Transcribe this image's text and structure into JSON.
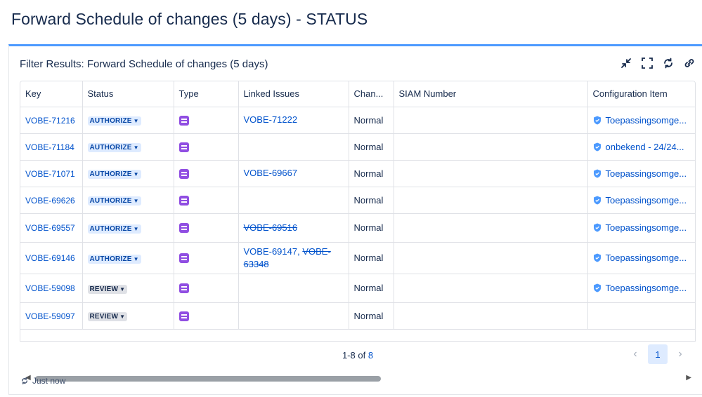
{
  "page": {
    "title": "Forward Schedule of changes (5 days) - STATUS"
  },
  "gadget": {
    "title": "Filter Results: Forward Schedule of changes (5 days)",
    "actions": [
      "minimize-icon",
      "fullscreen-icon",
      "refresh-icon",
      "link-icon"
    ]
  },
  "table": {
    "columns": [
      "Key",
      "Status",
      "Type",
      "Linked Issues",
      "Chan...",
      "SIAM Number",
      "Configuration Item"
    ],
    "rows": [
      {
        "key": "VOBE-71216",
        "status": "AUTHORIZE",
        "linked": [
          {
            "text": "VOBE-71222",
            "done": false
          }
        ],
        "change": "Normal",
        "siam": "",
        "ci": "Toepassingsomge..."
      },
      {
        "key": "VOBE-71184",
        "status": "AUTHORIZE",
        "linked": [],
        "change": "Normal",
        "siam": "",
        "ci": "onbekend - 24/24..."
      },
      {
        "key": "VOBE-71071",
        "status": "AUTHORIZE",
        "linked": [
          {
            "text": "VOBE-69667",
            "done": false
          }
        ],
        "change": "Normal",
        "siam": "",
        "ci": "Toepassingsomge..."
      },
      {
        "key": "VOBE-69626",
        "status": "AUTHORIZE",
        "linked": [],
        "change": "Normal",
        "siam": "",
        "ci": "Toepassingsomge..."
      },
      {
        "key": "VOBE-69557",
        "status": "AUTHORIZE",
        "linked": [
          {
            "text": "VOBE-69516",
            "done": true
          }
        ],
        "change": "Normal",
        "siam": "",
        "ci": "Toepassingsomge..."
      },
      {
        "key": "VOBE-69146",
        "status": "AUTHORIZE",
        "linked": [
          {
            "text": "VOBE-69147",
            "done": false
          },
          {
            "text": "VOBE-63348",
            "done": true
          }
        ],
        "change": "Normal",
        "siam": "",
        "ci": "Toepassingsomge..."
      },
      {
        "key": "VOBE-59098",
        "status": "REVIEW",
        "linked": [],
        "change": "Normal",
        "siam": "",
        "ci": "Toepassingsomge..."
      },
      {
        "key": "VOBE-59097",
        "status": "REVIEW",
        "linked": [],
        "change": "Normal",
        "siam": "",
        "ci": ""
      }
    ]
  },
  "pagination": {
    "range": "1-8 of",
    "total": "8",
    "current_page": "1"
  },
  "footer": {
    "refreshed": "Just now"
  },
  "colors": {
    "accent": "#4c9aff",
    "link": "#0052cc",
    "type_icon": "#904ee2",
    "authorize_badge": "#deebff",
    "review_badge": "#dfe1e6"
  }
}
